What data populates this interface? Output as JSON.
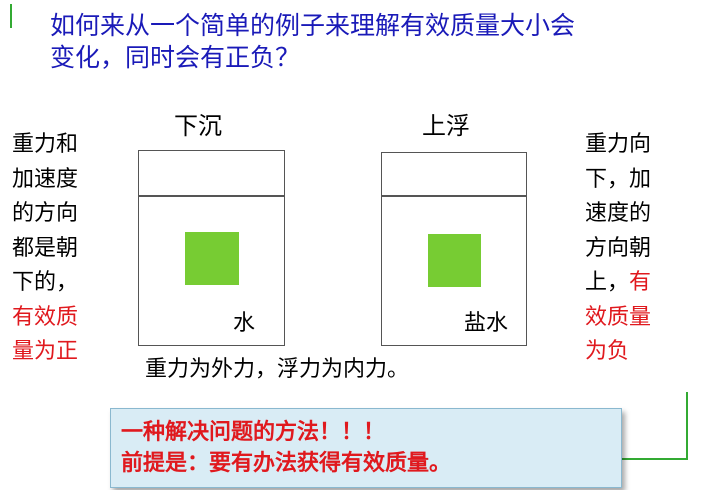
{
  "title": {
    "line1": "如何来从一个简单的例子来理解有效质量大小会",
    "line2": "变化，同时会有正负？"
  },
  "left_text": {
    "lines": [
      "重力和",
      "加速度",
      "的方向",
      "都是朝",
      "下的，"
    ],
    "red_lines": [
      "有效质",
      "量为正"
    ]
  },
  "right_text": {
    "lines": [
      "重力向",
      "下，加",
      "速度的",
      "方向朝"
    ],
    "mixed_line": {
      "normal": "上，",
      "red": "有"
    },
    "red_lines": [
      "效质量",
      "为负"
    ]
  },
  "beaker_left": {
    "caption": "下沉",
    "fluid": "水"
  },
  "beaker_right": {
    "caption": "上浮",
    "fluid": "盐水"
  },
  "bottom_note": "重力为外力，浮力为内力。",
  "callout": {
    "line1": "一种解决问题的方法！！！",
    "line2": "前提是：要有办法获得有效质量。"
  },
  "colors": {
    "title": "#1a1ab8",
    "emphasis": "#e0191e",
    "block": "#77cc33",
    "callout_bg": "#d9ecf5",
    "connector": "#33aa33"
  }
}
